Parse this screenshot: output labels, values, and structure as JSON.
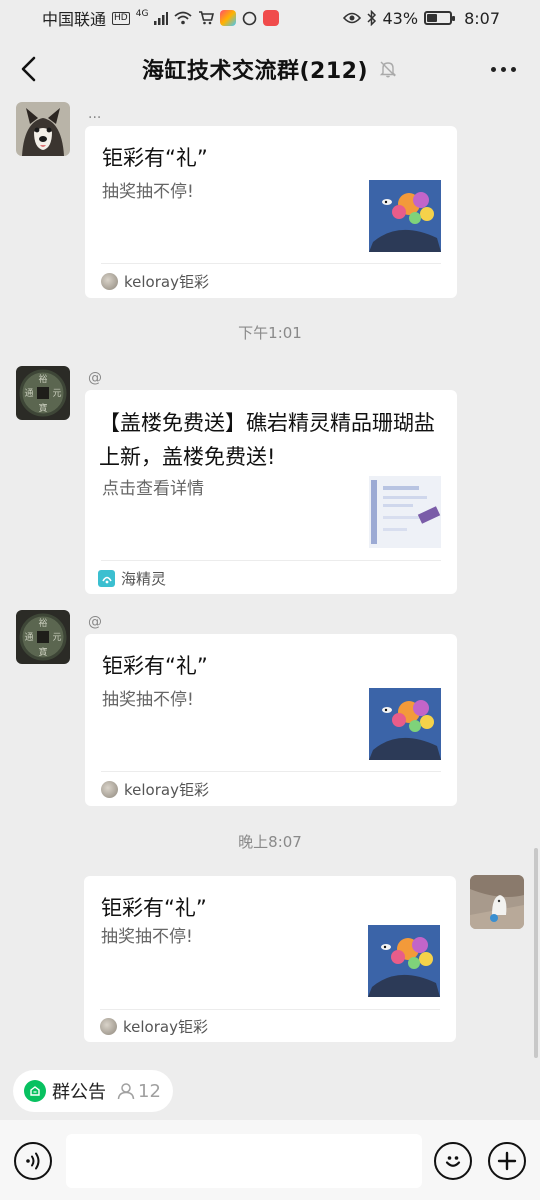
{
  "status_bar": {
    "carrier": "中国联通",
    "network_type": "4G",
    "battery_text": "43%",
    "battery_level": 0.43,
    "time": "8:07"
  },
  "header": {
    "title": "海缸技术交流群(212)",
    "back_icon": "chevron-left-icon",
    "mute_icon": "bell-mute-icon",
    "more_icon": "ellipsis-icon"
  },
  "messages": [
    {
      "sender_name": "...",
      "card": {
        "title": "钜彩有“礼”",
        "description": "抽奖抽不停!",
        "source_name": "keloray钜彩"
      }
    },
    {
      "time_separator": "下午1:01",
      "sender_name": "@",
      "card": {
        "title": "【盖楼免费送】礁岩精灵精品珊瑚盐上新，盖楼免费送!",
        "description": "点击查看详情",
        "source_name": "海精灵"
      }
    },
    {
      "sender_name": "@",
      "card": {
        "title": "钜彩有“礼”",
        "description": "抽奖抽不停!",
        "source_name": "keloray钜彩"
      }
    },
    {
      "time_separator": "晚上8:07",
      "card": {
        "title": "钜彩有“礼”",
        "description": "抽奖抽不停!",
        "source_name": "keloray钜彩"
      }
    }
  ],
  "announcement": {
    "label": "群公告",
    "member_count": "12"
  },
  "input_bar": {
    "placeholder": "",
    "voice_icon": "voice-icon",
    "emoji_icon": "emoji-icon",
    "plus_icon": "plus-icon"
  },
  "colors": {
    "background": "#ededed",
    "accent_green": "#07c160",
    "card_bg": "#ffffff"
  }
}
